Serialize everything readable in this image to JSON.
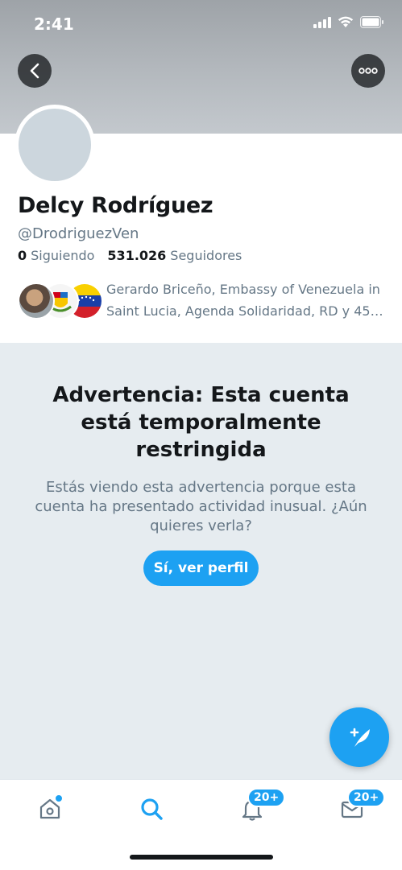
{
  "status_bar": {
    "time": "2:41"
  },
  "header": {
    "back_icon": "chevron-left-icon",
    "more_icon": "more-horizontal-icon"
  },
  "profile": {
    "name": "Delcy Rodríguez",
    "handle": "@DrodriguezVen",
    "following_count": "0",
    "following_label": "Siguiendo",
    "followers_count": "531.026",
    "followers_label": "Seguidores",
    "followers_you_know_line1": "Gerardo Briceño, Embassy of Venezuela in",
    "followers_you_know_line2": "Saint Lucia, Agenda Solidaridad, RD y 45…"
  },
  "warning": {
    "title": "Advertencia: Esta cuenta está temporalmente restringida",
    "body": "Estás viendo esta advertencia porque esta cuenta ha presentado actividad inusual. ¿Aún quieres verla?",
    "button_label": "Sí, ver perfil"
  },
  "tabbar": {
    "notifications_badge": "20+",
    "messages_badge": "20+",
    "active_tab": "search"
  },
  "colors": {
    "accent": "#1da1f2",
    "warning_bg": "#e6ecf0",
    "secondary_text": "#657786"
  }
}
